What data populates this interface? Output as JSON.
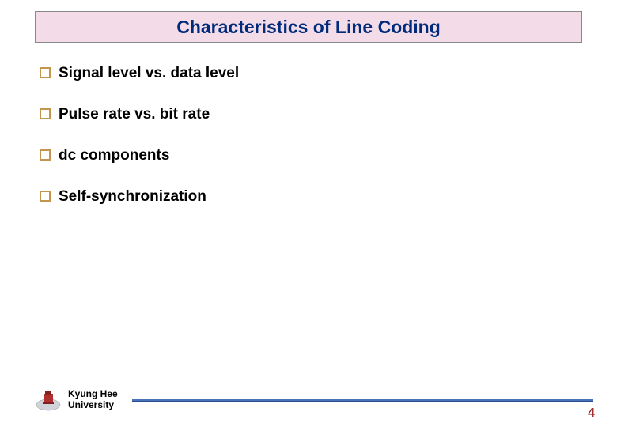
{
  "title": "Characteristics of Line Coding",
  "bullets": [
    "Signal level vs. data level",
    "Pulse rate vs. bit rate",
    "dc components",
    "Self-synchronization"
  ],
  "footer": {
    "university_line1": "Kyung Hee",
    "university_line2": "University"
  },
  "page_number": "4"
}
